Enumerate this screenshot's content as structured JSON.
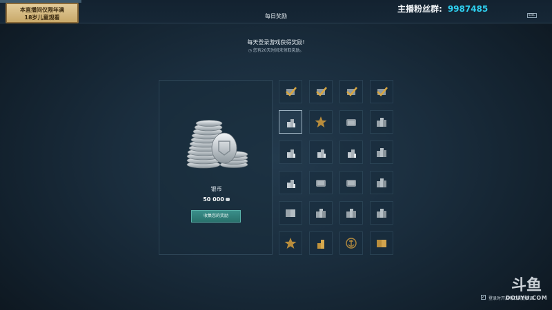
{
  "header": {
    "plaque_line1": "本直播间仅限年满",
    "plaque_line2": "18岁儿童观看",
    "title": "每日奖励",
    "fans_label": "主播粉丝群:",
    "fans_number": "9987485",
    "esc_label": "ESC"
  },
  "intro": {
    "subtitle": "每天登录游戏获得奖励!",
    "days_note": "◷ 您有20天时间来领取奖励。"
  },
  "reward": {
    "name": "银币",
    "amount": "50 000",
    "collect_label": "收集您的奖励"
  },
  "grid": {
    "cells": [
      {
        "icon": "check-icon",
        "state": "collected"
      },
      {
        "icon": "check-icon",
        "state": "collected"
      },
      {
        "icon": "check-icon",
        "state": "collected"
      },
      {
        "icon": "check-icon",
        "state": "collected"
      },
      {
        "icon": "coins-icon",
        "state": "today"
      },
      {
        "icon": "star-icon",
        "state": "upcoming"
      },
      {
        "icon": "crate-icon",
        "state": "upcoming"
      },
      {
        "icon": "container-icon",
        "state": "upcoming"
      },
      {
        "icon": "coins-icon",
        "state": "upcoming"
      },
      {
        "icon": "coins-icon",
        "state": "upcoming"
      },
      {
        "icon": "coins-icon",
        "state": "upcoming"
      },
      {
        "icon": "container-icon",
        "state": "upcoming"
      },
      {
        "icon": "coins-icon",
        "state": "upcoming"
      },
      {
        "icon": "crate-icon",
        "state": "upcoming"
      },
      {
        "icon": "crate-icon",
        "state": "upcoming"
      },
      {
        "icon": "container-icon",
        "state": "upcoming"
      },
      {
        "icon": "book-icon",
        "state": "upcoming"
      },
      {
        "icon": "container-icon",
        "state": "upcoming"
      },
      {
        "icon": "container-icon",
        "state": "upcoming"
      },
      {
        "icon": "container-icon",
        "state": "upcoming"
      },
      {
        "icon": "star-icon",
        "state": "upcoming"
      },
      {
        "icon": "gold-coins-icon",
        "state": "upcoming"
      },
      {
        "icon": "anchor-emblem-icon",
        "state": "upcoming"
      },
      {
        "icon": "gold-book-icon",
        "state": "upcoming"
      }
    ]
  },
  "footer": {
    "check_mark": "✓",
    "text": "登录时开启每日奖励页面"
  },
  "watermark": {
    "logo_text": "斗鱼",
    "site": "DOUYU.COM"
  },
  "colors": {
    "accent_cyan": "#2ed0f0",
    "button_teal": "#2f7d78",
    "gold": "#c99a3a",
    "silver": "#bfc7cd"
  }
}
